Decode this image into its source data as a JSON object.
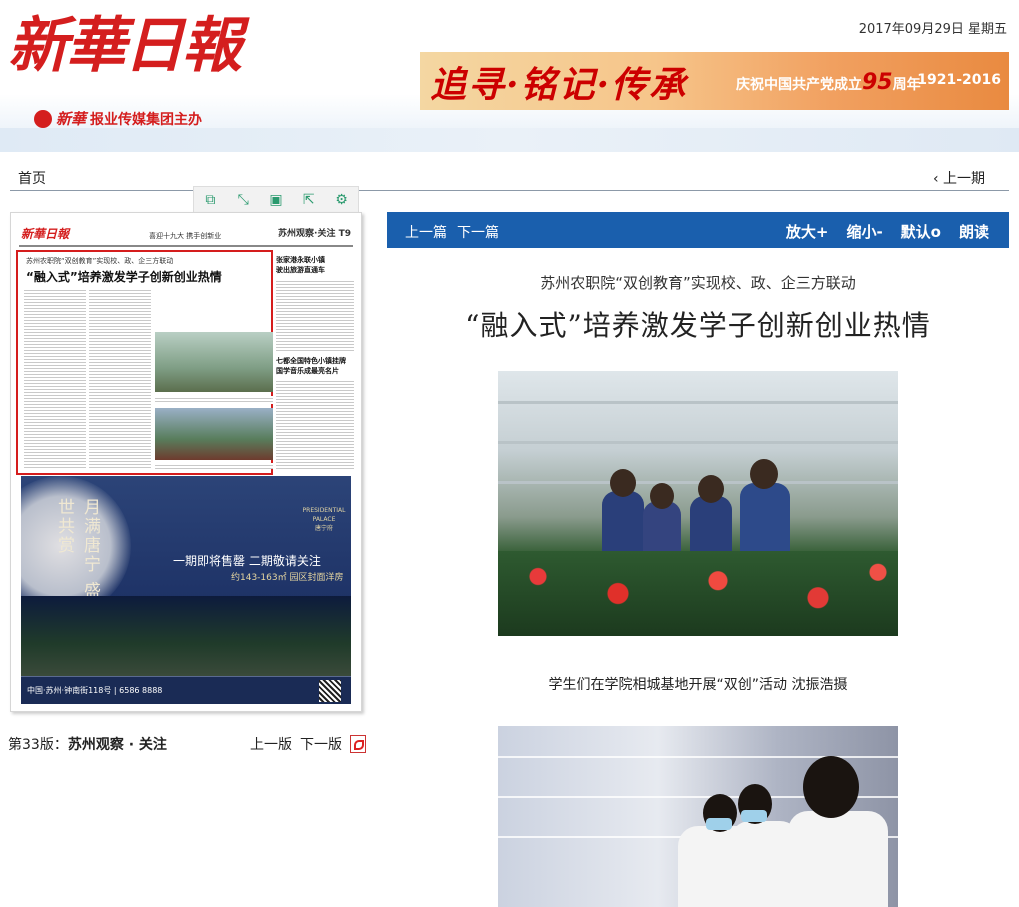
{
  "masthead": {
    "logo_title": "新華日報",
    "logo_sub_italic": "新華",
    "logo_sub": "报业传媒集团主办",
    "date": "2017年09月29日 星期五",
    "banner": {
      "slogan": "追寻·铭记·传承",
      "celebration_prefix": "庆祝中国共产党成立",
      "celebration_num": "95",
      "celebration_suffix": "周年",
      "years": "1921-2016"
    }
  },
  "nav": {
    "home": "首页",
    "prev_issue": "上一期",
    "prev_icon": "‹"
  },
  "toolbar": {
    "icons": [
      "copy-icon",
      "fullscreen-icon",
      "save-icon",
      "share-icon",
      "settings-icon"
    ],
    "glyphs": [
      "⧉",
      "⤡",
      "▣",
      "⇱",
      "⚙"
    ]
  },
  "paper": {
    "logo": "新華日報",
    "header_mid": "喜迎十九大 携手创新业",
    "header_right": "苏州观察·关注 T9",
    "box_small": "苏州农职院“双创教育”实现校、政、企三方联动",
    "box_headline": "“融入式”培养激发学子创新创业热情",
    "side1_line1": "张家港永联小镇",
    "side1_line2": "驶出旅游直通车",
    "side2_line1": "七都全国特色小镇挂牌",
    "side2_line2": "国学音乐成最亮名片",
    "ad": {
      "poem": "月满唐宁 盛世共赏",
      "brand_en": "PRESIDENTIAL PALACE",
      "brand_cn": "唐宁府",
      "line1": "一期即将售罄 二期敬请关注",
      "line2": "约143-163㎡ 园区封面洋房",
      "footer": "中国·苏州·钟南街118号 | 6586 8888"
    }
  },
  "edition": {
    "prefix": "第33版：",
    "name": "苏州观察 · 关注",
    "prev": "上一版",
    "next": "下一版"
  },
  "article_bar": {
    "prev": "上一篇",
    "next": "下一篇",
    "zoom_in": "放大+",
    "zoom_out": "缩小-",
    "default": "默认o",
    "read": "朗读"
  },
  "article": {
    "subtitle": "苏州农职院“双创教育”实现校、政、企三方联动",
    "headline": "“融入式”培养激发学子创新创业热情",
    "caption1": "学生们在学院相城基地开展“双创”活动 沈振浩摄"
  }
}
